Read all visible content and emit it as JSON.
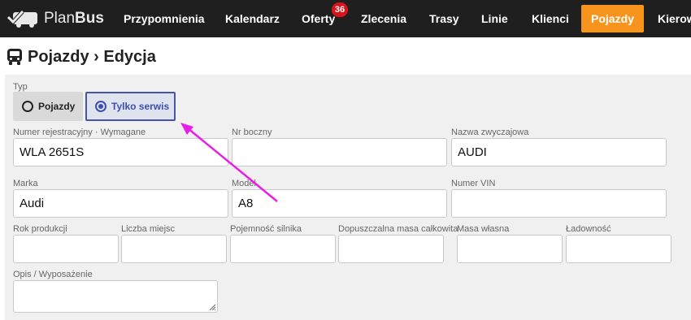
{
  "nav": {
    "brand_light": "Plan",
    "brand_bold": "Bus",
    "items": [
      {
        "label": "Przypomnienia"
      },
      {
        "label": "Kalendarz"
      },
      {
        "label": "Oferty"
      },
      {
        "label": "Zlecenia"
      },
      {
        "label": "Trasy"
      },
      {
        "label": "Linie"
      },
      {
        "label": "Klienci"
      },
      {
        "label": "Pojazdy"
      },
      {
        "label": "Kierow"
      }
    ],
    "offers_badge": "36",
    "active_item": "Pojazdy",
    "active_color": "#f7941d"
  },
  "page": {
    "title": "Pojazdy › Edycja"
  },
  "form": {
    "type_label": "Typ",
    "type_options": [
      {
        "label": "Pojazdy",
        "selected": false
      },
      {
        "label": "Tylko serwis",
        "selected": true
      }
    ],
    "fields": {
      "registration": {
        "label": "Numer rejestracyjny · Wymagane",
        "value": "WLA 2651S"
      },
      "side_number": {
        "label": "Nr boczny",
        "value": ""
      },
      "common_name": {
        "label": "Nazwa zwyczajowa",
        "value": "AUDI"
      },
      "brand": {
        "label": "Marka",
        "value": "Audi"
      },
      "model": {
        "label": "Model",
        "value": "A8"
      },
      "vin": {
        "label": "Numer VIN",
        "value": ""
      },
      "production_year": {
        "label": "Rok produkcji",
        "value": ""
      },
      "seats": {
        "label": "Liczba miejsc",
        "value": ""
      },
      "engine_capacity": {
        "label": "Pojemność silnika",
        "value": ""
      },
      "max_mass": {
        "label": "Dopuszczalna masa całkowita",
        "value": ""
      },
      "own_mass": {
        "label": "Masa własna",
        "value": ""
      },
      "load_capacity": {
        "label": "Ładowność",
        "value": ""
      },
      "description": {
        "label": "Opis / Wyposażenie",
        "value": ""
      }
    }
  },
  "annotation": {
    "arrow_color": "#e81ee8"
  }
}
